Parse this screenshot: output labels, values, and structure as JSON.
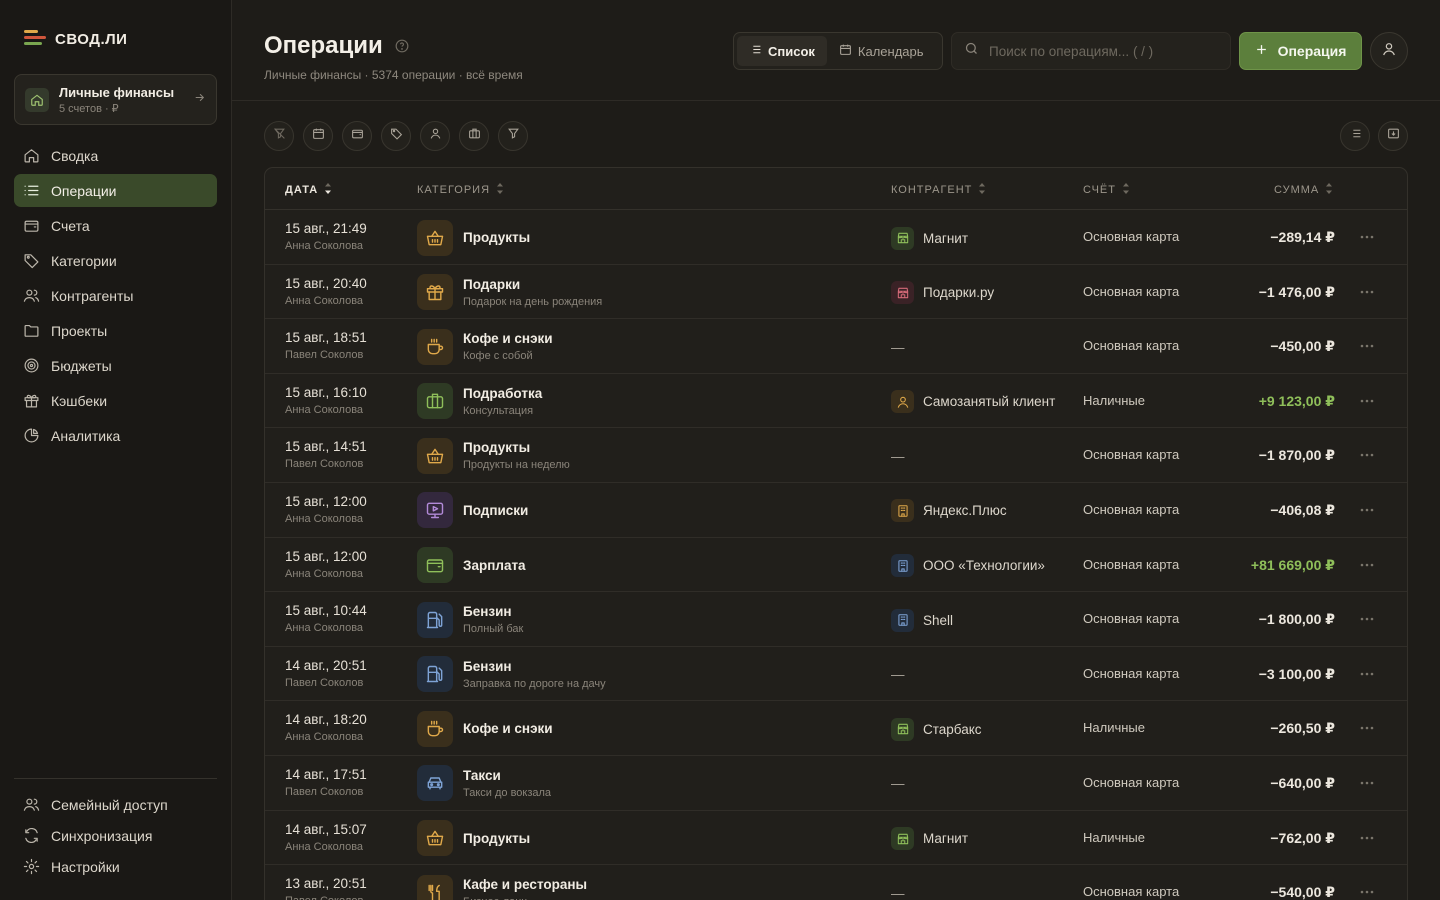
{
  "app": {
    "name": "СВОД.ЛИ"
  },
  "workspace": {
    "title": "Личные финансы",
    "subtitle": "5 счетов · ₽"
  },
  "nav": [
    {
      "label": "Сводка",
      "icon": "home-icon"
    },
    {
      "label": "Операции",
      "icon": "list-icon",
      "active": true
    },
    {
      "label": "Счета",
      "icon": "wallet-icon"
    },
    {
      "label": "Категории",
      "icon": "tag-icon"
    },
    {
      "label": "Контрагенты",
      "icon": "users-icon"
    },
    {
      "label": "Проекты",
      "icon": "folder-icon"
    },
    {
      "label": "Бюджеты",
      "icon": "target-icon"
    },
    {
      "label": "Кэшбеки",
      "icon": "gift-icon"
    },
    {
      "label": "Аналитика",
      "icon": "pie-icon"
    }
  ],
  "nav_bottom": [
    {
      "label": "Семейный доступ",
      "icon": "users-icon"
    },
    {
      "label": "Синхронизация",
      "icon": "sync-icon"
    },
    {
      "label": "Настройки",
      "icon": "gear-icon"
    }
  ],
  "header": {
    "title": "Операции",
    "subtitle": "Личные финансы · 5374 операции · всё время",
    "view_list": "Список",
    "view_calendar": "Календарь",
    "search_placeholder": "Поиск по операциям... ( / )",
    "add_label": "Операция"
  },
  "table": {
    "columns": {
      "date": "ДАТА",
      "category": "КАТЕГОРИЯ",
      "counterparty": "КОНТРАГЕНТ",
      "account": "СЧЁТ",
      "amount": "СУММА"
    },
    "rows": [
      {
        "date": "15 авг., 21:49",
        "user": "Анна Соколова",
        "category": "Продукты",
        "note": "",
        "cat_icon": "basket-icon",
        "cat_tone": "orange",
        "counterparty": "Магнит",
        "cp_icon": "store-icon",
        "cp_tone": "green",
        "account": "Основная карта",
        "amount": "−289,14 ₽",
        "positive": false
      },
      {
        "date": "15 авг., 20:40",
        "user": "Анна Соколова",
        "category": "Подарки",
        "note": "Подарок на день рождения",
        "cat_icon": "gift-icon",
        "cat_tone": "orange",
        "counterparty": "Подарки.ру",
        "cp_icon": "store-icon",
        "cp_tone": "red",
        "account": "Основная карта",
        "amount": "−1 476,00 ₽",
        "positive": false
      },
      {
        "date": "15 авг., 18:51",
        "user": "Павел Соколов",
        "category": "Кофе и снэки",
        "note": "Кофе с собой",
        "cat_icon": "cup-icon",
        "cat_tone": "orange",
        "counterparty": "—",
        "cp_icon": "",
        "cp_tone": "",
        "account": "Основная карта",
        "amount": "−450,00 ₽",
        "positive": false
      },
      {
        "date": "15 авг., 16:10",
        "user": "Анна Соколова",
        "category": "Подработка",
        "note": "Консультация",
        "cat_icon": "briefcase-icon",
        "cat_tone": "green",
        "counterparty": "Самозанятый клиент",
        "cp_icon": "person-icon",
        "cp_tone": "orange",
        "account": "Наличные",
        "amount": "+9 123,00 ₽",
        "positive": true
      },
      {
        "date": "15 авг., 14:51",
        "user": "Павел Соколов",
        "category": "Продукты",
        "note": "Продукты на неделю",
        "cat_icon": "basket-icon",
        "cat_tone": "orange",
        "counterparty": "—",
        "cp_icon": "",
        "cp_tone": "",
        "account": "Основная карта",
        "amount": "−1 870,00 ₽",
        "positive": false
      },
      {
        "date": "15 авг., 12:00",
        "user": "Анна Соколова",
        "category": "Подписки",
        "note": "",
        "cat_icon": "monitor-play-icon",
        "cat_tone": "purple",
        "counterparty": "Яндекс.Плюс",
        "cp_icon": "building-icon",
        "cp_tone": "orange",
        "account": "Основная карта",
        "amount": "−406,08 ₽",
        "positive": false
      },
      {
        "date": "15 авг., 12:00",
        "user": "Анна Соколова",
        "category": "Зарплата",
        "note": "",
        "cat_icon": "wallet-icon",
        "cat_tone": "green",
        "counterparty": "ООО «Технологии»",
        "cp_icon": "building-icon",
        "cp_tone": "blue",
        "account": "Основная карта",
        "amount": "+81 669,00 ₽",
        "positive": true
      },
      {
        "date": "15 авг., 10:44",
        "user": "Анна Соколова",
        "category": "Бензин",
        "note": "Полный бак",
        "cat_icon": "fuel-icon",
        "cat_tone": "blue",
        "counterparty": "Shell",
        "cp_icon": "building-icon",
        "cp_tone": "blue",
        "account": "Основная карта",
        "amount": "−1 800,00 ₽",
        "positive": false
      },
      {
        "date": "14 авг., 20:51",
        "user": "Павел Соколов",
        "category": "Бензин",
        "note": "Заправка по дороге на дачу",
        "cat_icon": "fuel-icon",
        "cat_tone": "blue",
        "counterparty": "—",
        "cp_icon": "",
        "cp_tone": "",
        "account": "Основная карта",
        "amount": "−3 100,00 ₽",
        "positive": false
      },
      {
        "date": "14 авг., 18:20",
        "user": "Анна Соколова",
        "category": "Кофе и снэки",
        "note": "",
        "cat_icon": "cup-icon",
        "cat_tone": "orange",
        "counterparty": "Старбакс",
        "cp_icon": "store-icon",
        "cp_tone": "green",
        "account": "Наличные",
        "amount": "−260,50 ₽",
        "positive": false
      },
      {
        "date": "14 авг., 17:51",
        "user": "Павел Соколов",
        "category": "Такси",
        "note": "Такси до вокзала",
        "cat_icon": "car-icon",
        "cat_tone": "blue",
        "counterparty": "—",
        "cp_icon": "",
        "cp_tone": "",
        "account": "Основная карта",
        "amount": "−640,00 ₽",
        "positive": false
      },
      {
        "date": "14 авг., 15:07",
        "user": "Анна Соколова",
        "category": "Продукты",
        "note": "",
        "cat_icon": "basket-icon",
        "cat_tone": "orange",
        "counterparty": "Магнит",
        "cp_icon": "store-icon",
        "cp_tone": "green",
        "account": "Наличные",
        "amount": "−762,00 ₽",
        "positive": false
      },
      {
        "date": "13 авг., 20:51",
        "user": "Павел Соколов",
        "category": "Кафе и рестораны",
        "note": "Бизнес-ланч",
        "cat_icon": "fork-knife-icon",
        "cat_tone": "orange",
        "counterparty": "—",
        "cp_icon": "",
        "cp_tone": "",
        "account": "Основная карта",
        "amount": "−540,00 ₽",
        "positive": false
      }
    ]
  },
  "colors": {
    "accent": "#5c7f3c",
    "positive": "#8fbf5a",
    "background": "#1e1c18"
  }
}
